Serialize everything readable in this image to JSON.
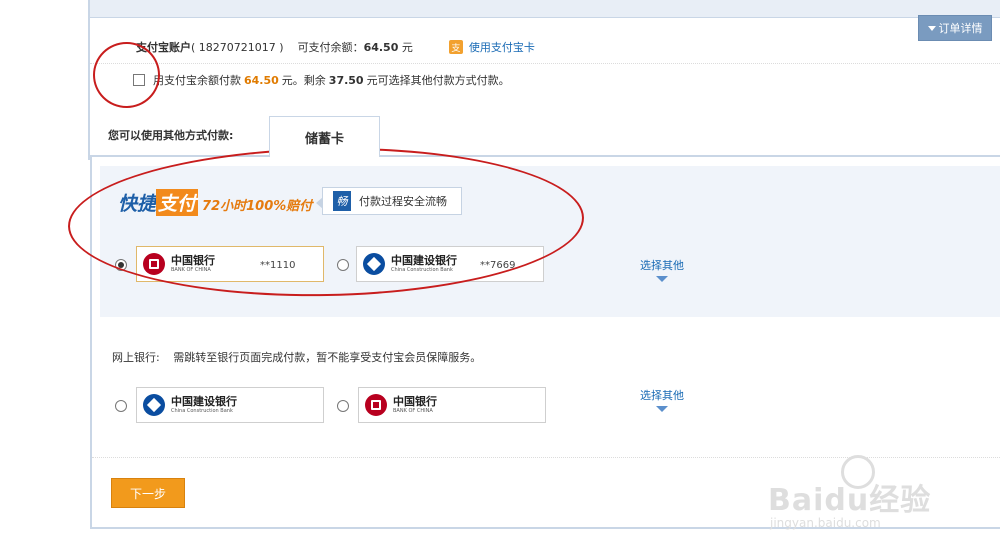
{
  "header": {
    "order_detail": "订单详情"
  },
  "account": {
    "label": "支付宝账户",
    "number": "( 18270721017 )",
    "balance_label": "可支付余额",
    "balance_value": "64.50",
    "balance_unit": "元",
    "alipay_icon": "支",
    "use_card_link": "使用支付宝卡"
  },
  "balance_option": {
    "text1": "用支付宝余额付款",
    "amount": "64.50",
    "text2": "元。剩余",
    "remaining": "37.50",
    "text3": "元可选择其他付款方式付款。"
  },
  "tabs": {
    "label": "您可以使用其他方式付款:",
    "active": "储蓄卡"
  },
  "quick_pay": {
    "logo_part1": "快捷",
    "logo_part2": "支付",
    "logo_part3": "72小时100%赔付",
    "safe_icon": "畅",
    "safe_text": "付款过程安全流畅"
  },
  "quick_cards": [
    {
      "bank": "中国银行",
      "bank_en": "BANK OF CHINA",
      "card": "**1110",
      "selected": true
    },
    {
      "bank": "中国建设银行",
      "bank_en": "China Construction Bank",
      "card": "**7669",
      "selected": false
    }
  ],
  "more_label": "选择其他",
  "netbank": {
    "label": "网上银行:",
    "note": "需跳转至银行页面完成付款，暂不能享受支付宝会员保障服务。",
    "banks": [
      {
        "bank": "中国建设银行",
        "bank_en": "China Construction Bank"
      },
      {
        "bank": "中国银行",
        "bank_en": "BANK OF CHINA"
      }
    ]
  },
  "next_button": "下一步",
  "watermark": {
    "main": "Baidu经验",
    "sub": "jingyan.baidu.com"
  },
  "colors": {
    "accent_blue": "#1a6bb5",
    "orange": "#f29a1c",
    "annotation_red": "#c81d1d"
  }
}
